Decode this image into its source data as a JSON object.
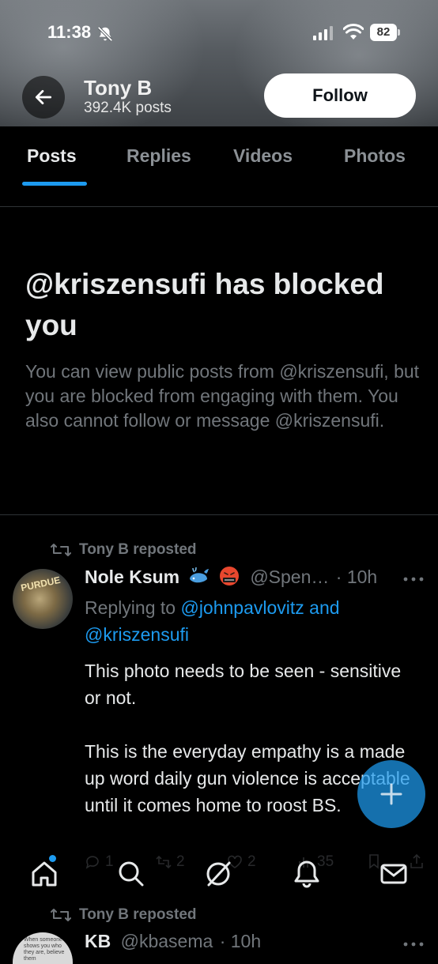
{
  "status_bar": {
    "time": "11:38",
    "battery": "82"
  },
  "profile": {
    "name": "Tony B",
    "posts": "392.4K posts",
    "follow_label": "Follow"
  },
  "tabs": [
    {
      "label": "Posts"
    },
    {
      "label": "Replies"
    },
    {
      "label": "Videos"
    },
    {
      "label": "Photos"
    }
  ],
  "blocked": {
    "title": "@kriszensufi has blocked you",
    "body": "You can view public posts from @kriszensufi, but you are blocked from engaging with them. You also cannot follow or message @kriszensufi."
  },
  "post1": {
    "repost_label": "Tony B reposted",
    "author": "Nole Ksum",
    "handle": "@Spen…",
    "time": "· 10h",
    "replying_prefix": "Replying to ",
    "replying_mention1": "@johnpavlovitz",
    "replying_and": " and",
    "replying_mention2": "@kriszensufi",
    "text": "This photo needs to be seen - sensitive or not.\n\nThis is the everyday empathy is a made up word daily gun violence is acceptable until it comes home to roost BS.",
    "avatar_text": "PURDUE",
    "stats": {
      "replies": "1",
      "reposts": "2",
      "likes": "2",
      "views": "35"
    }
  },
  "post2": {
    "repost_label": "Tony B reposted",
    "author": "KB",
    "handle": "@kbasema",
    "time": "· 10h",
    "avatar_text": "When someone shows you who they are, believe them"
  },
  "colors": {
    "accent": "#1d9bf0",
    "background": "#000000",
    "muted": "#71767b",
    "text": "#e7e9ea"
  },
  "icons": {
    "back": "arrow-left-icon",
    "status": [
      "bell-off-icon",
      "signal-icon",
      "wifi-icon",
      "battery-icon"
    ],
    "nav": [
      "home-icon",
      "search-icon",
      "grok-icon",
      "notifications-icon",
      "messages-icon"
    ],
    "fab": "plus-icon"
  }
}
